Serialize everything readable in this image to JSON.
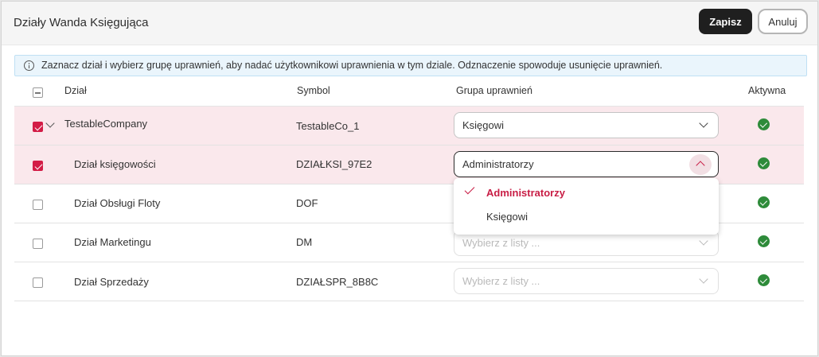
{
  "header": {
    "title": "Działy Wanda Księgująca",
    "save_label": "Zapisz",
    "cancel_label": "Anuluj"
  },
  "info": {
    "icon": "info-icon",
    "text": "Zaznacz dział i wybierz grupę uprawnień, aby nadać użytkownikowi uprawnienia w tym dziale. Odznaczenie spowoduje usunięcie uprawnień."
  },
  "table": {
    "columns": {
      "name": "Dział",
      "symbol": "Symbol",
      "group": "Grupa uprawnień",
      "active": "Aktywna"
    },
    "rows": [
      {
        "name": "TestableCompany",
        "symbol": "TestableCo_1",
        "group": "Księgowi",
        "placeholder": "",
        "checked": true,
        "active": true
      },
      {
        "name": "Dział księgowości",
        "symbol": "DZIAŁKSI_97E2",
        "group": "Administratorzy",
        "placeholder": "",
        "checked": true,
        "active": true
      },
      {
        "name": "Dział Obsługi Floty",
        "symbol": "DOF",
        "group": "",
        "placeholder": "",
        "checked": false,
        "active": true
      },
      {
        "name": "Dział Marketingu",
        "symbol": "DM",
        "group": "",
        "placeholder": "Wybierz z listy ...",
        "checked": false,
        "active": true
      },
      {
        "name": "Dział Sprzedaży",
        "symbol": "DZIAŁSPR_8B8C",
        "group": "",
        "placeholder": "Wybierz z listy ...",
        "checked": false,
        "active": true
      }
    ]
  },
  "dropdown": {
    "options": [
      {
        "label": "Administratorzy",
        "selected": true
      },
      {
        "label": "Księgowi",
        "selected": false
      }
    ]
  },
  "colors": {
    "accent": "#d31c46",
    "selected_row": "#fae8ec",
    "active_green": "#2e8b3a",
    "primary_button": "#1f1f1f"
  }
}
